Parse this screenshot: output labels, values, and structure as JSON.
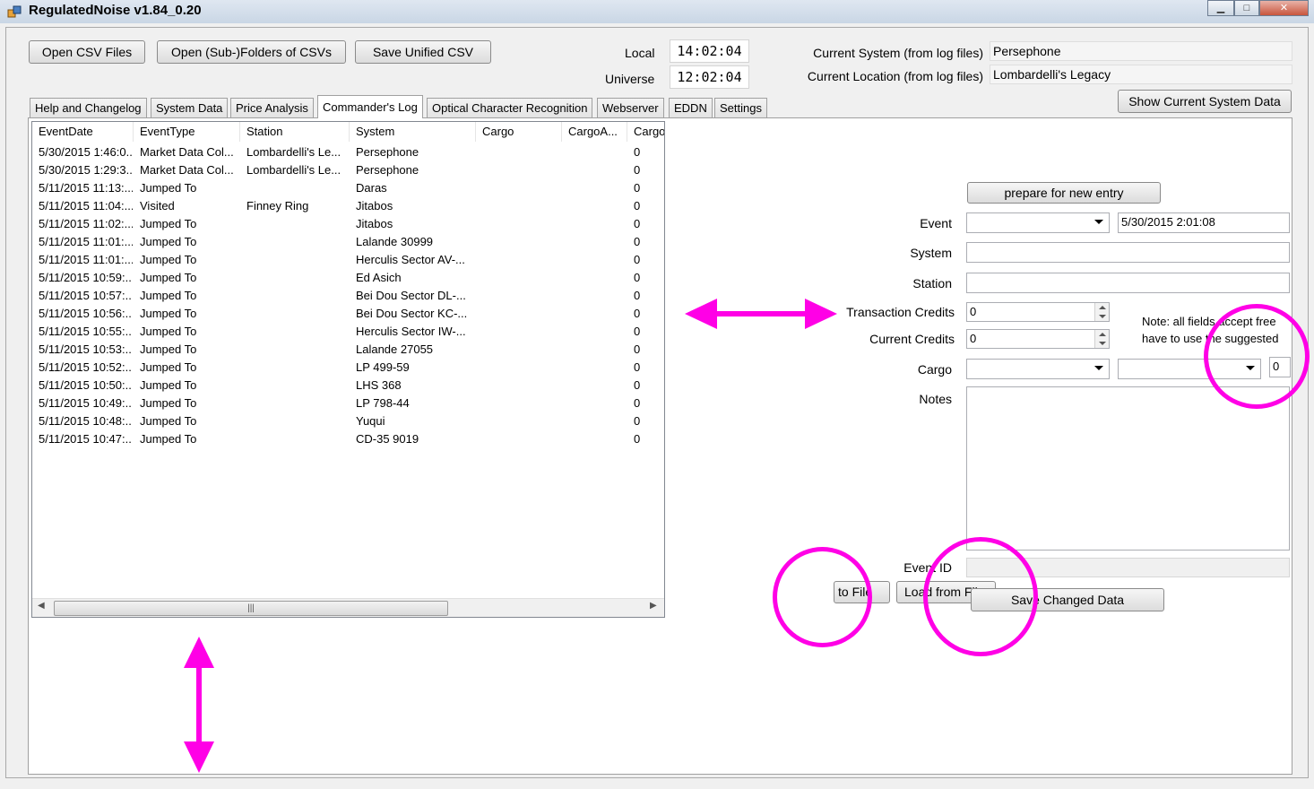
{
  "window": {
    "title": "RegulatedNoise v1.84_0.20",
    "minimize_label": "▁",
    "maximize_label": "□",
    "close_label": "✕"
  },
  "toolbar": {
    "open_csv": "Open CSV Files",
    "open_folders": "Open (Sub-)Folders of CSVs",
    "save_unified": "Save Unified CSV"
  },
  "clock": {
    "local_label": "Local",
    "local_time": "14:02:04",
    "universe_label": "Universe",
    "universe_time": "12:02:04"
  },
  "status": {
    "system_label": "Current System (from log files)",
    "system_value": "Persephone",
    "location_label": "Current Location (from log files)",
    "location_value": "Lombardelli's Legacy",
    "show_system_button": "Show Current System Data"
  },
  "tabs": [
    {
      "label": "Help and Changelog"
    },
    {
      "label": "System Data"
    },
    {
      "label": "Price Analysis"
    },
    {
      "label": "Commander's Log"
    },
    {
      "label": "Optical Character Recognition"
    },
    {
      "label": "Webserver"
    },
    {
      "label": "EDDN"
    },
    {
      "label": "Settings"
    }
  ],
  "log_table": {
    "headers": [
      "EventDate",
      "EventType",
      "Station",
      "System",
      "Cargo",
      "CargoA...",
      "Cargo"
    ],
    "rows": [
      [
        "5/30/2015 1:46:0...",
        "Market Data Col...",
        "Lombardelli's Le...",
        "Persephone",
        "",
        "",
        "0"
      ],
      [
        "5/30/2015 1:29:3...",
        "Market Data Col...",
        "Lombardelli's Le...",
        "Persephone",
        "",
        "",
        "0"
      ],
      [
        "5/11/2015 11:13:...",
        "Jumped To",
        "",
        "Daras",
        "",
        "",
        "0"
      ],
      [
        "5/11/2015 11:04:...",
        "Visited",
        "Finney Ring",
        "Jitabos",
        "",
        "",
        "0"
      ],
      [
        "5/11/2015 11:02:...",
        "Jumped To",
        "",
        "Jitabos",
        "",
        "",
        "0"
      ],
      [
        "5/11/2015 11:01:...",
        "Jumped To",
        "",
        "Lalande 30999",
        "",
        "",
        "0"
      ],
      [
        "5/11/2015 11:01:...",
        "Jumped To",
        "",
        "Herculis Sector AV-...",
        "",
        "",
        "0"
      ],
      [
        "5/11/2015 10:59:...",
        "Jumped To",
        "",
        "Ed Asich",
        "",
        "",
        "0"
      ],
      [
        "5/11/2015 10:57:...",
        "Jumped To",
        "",
        "Bei Dou Sector DL-...",
        "",
        "",
        "0"
      ],
      [
        "5/11/2015 10:56:...",
        "Jumped To",
        "",
        "Bei Dou Sector KC-...",
        "",
        "",
        "0"
      ],
      [
        "5/11/2015 10:55:...",
        "Jumped To",
        "",
        "Herculis Sector IW-...",
        "",
        "",
        "0"
      ],
      [
        "5/11/2015 10:53:...",
        "Jumped To",
        "",
        "Lalande 27055",
        "",
        "",
        "0"
      ],
      [
        "5/11/2015 10:52:...",
        "Jumped To",
        "",
        "LP 499-59",
        "",
        "",
        "0"
      ],
      [
        "5/11/2015 10:50:...",
        "Jumped To",
        "",
        "LHS 368",
        "",
        "",
        "0"
      ],
      [
        "5/11/2015 10:49:...",
        "Jumped To",
        "",
        "LP 798-44",
        "",
        "",
        "0"
      ],
      [
        "5/11/2015 10:48:...",
        "Jumped To",
        "",
        "Yuqui",
        "",
        "",
        "0"
      ],
      [
        "5/11/2015 10:47:...",
        "Jumped To",
        "",
        "CD-35 9019",
        "",
        "",
        "0"
      ]
    ],
    "scroll_grip": "|||",
    "scroll_left": "◀",
    "scroll_right": "▶"
  },
  "form": {
    "prepare_button": "prepare for new entry",
    "event_label": "Event",
    "event_value": "",
    "event_date": "5/30/2015   2:01:08",
    "system_label": "System",
    "system_value": "",
    "station_label": "Station",
    "station_value": "",
    "transaction_label": "Transaction Credits",
    "transaction_value": "0",
    "current_credits_label": "Current Credits",
    "current_credits_value": "0",
    "note_line1": "Note: all fields accept free",
    "note_line2": "have to use the suggested",
    "cargo_label": "Cargo",
    "cargo_amount": "0",
    "notes_label": "Notes",
    "notes_value": "",
    "event_id_label": "Event ID",
    "event_id_value": "",
    "to_file_button": "to File",
    "load_from_file_button": "Load from File",
    "save_changed_button": "Save Changed Data"
  },
  "annotation_colors": {
    "highlight": "#ff00e6"
  }
}
